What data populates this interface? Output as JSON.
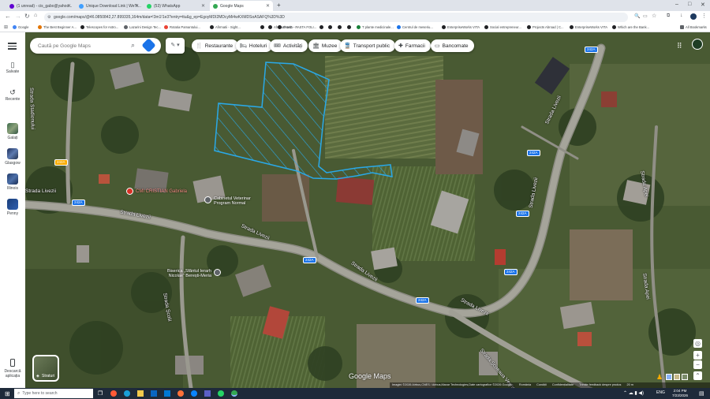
{
  "browser": {
    "tabs": [
      {
        "label": "(1 unread) - cis_gabo@yahoo...",
        "color": "#6001d2"
      },
      {
        "label": "Unique Download Link | WeTr...",
        "color": "#409fff"
      },
      {
        "label": "(53) WhatsApp",
        "color": "#25d366"
      },
      {
        "label": "Google Maps",
        "color": "#34a853"
      }
    ],
    "url": "google.com/maps/@46.0850842,27.899335,164m/data=!3m1!1e3?entry=ttu&g_ep=EgoyMDI2MDcyMi4wKXMDSoASAFQ%3D%3D",
    "bookmarks": [
      "Google",
      "The Best Beginner A...",
      "Telescopes for Astro...",
      "Lazarini Design Tec...",
      "Rotatia Pamantului...",
      "Afirmatii - Sight...",
      "Afrosudnaria - ...",
      "FAMD - PASTA FOLI...",
      "T plante medicinale...",
      "Centrul de meseriu...",
      "EnterpriseWorks VITA",
      "Social entrepreneur...",
      "Projects Abroad | C...",
      "EnterpriseWorks VITA",
      "Which are the Bank..."
    ],
    "all_bookmarks": "All Bookmarks"
  },
  "rail": {
    "items": [
      {
        "label": "Salvate"
      },
      {
        "label": "Recente"
      },
      {
        "label": "Galați"
      },
      {
        "label": "Glasgow"
      },
      {
        "label": "Illinois"
      },
      {
        "label": "Penny"
      }
    ],
    "download_label": "Descarcă aplicația"
  },
  "search": {
    "placeholder": "Caută pe Google Maps"
  },
  "chips": [
    {
      "label": "Restaurante",
      "icon": "fork-knife-icon"
    },
    {
      "label": "Hoteluri",
      "icon": "bed-icon"
    },
    {
      "label": "Activități",
      "icon": "ticket-icon"
    },
    {
      "label": "Muzee",
      "icon": "museum-icon"
    },
    {
      "label": "Transport public",
      "icon": "train-icon"
    },
    {
      "label": "Farmacii",
      "icon": "pharmacy-icon"
    },
    {
      "label": "Bancomate",
      "icon": "atm-icon"
    }
  ],
  "map": {
    "streets": [
      {
        "name": "Strada Stadionului"
      },
      {
        "name": "Strada Livezii"
      },
      {
        "name": "Strada Livezii"
      },
      {
        "name": "Strada Livezii"
      },
      {
        "name": "Strada Livezii"
      },
      {
        "name": "Strada Livezii"
      },
      {
        "name": "Strada Livezii"
      },
      {
        "name": "Strada Livezii"
      },
      {
        "name": "Strada Școlii"
      },
      {
        "name": "Strada Apei"
      },
      {
        "name": "Strada Apei"
      },
      {
        "name": "Strada Șoseaua Veche"
      }
    ],
    "shields": [
      "242A",
      "242A",
      "242A",
      "242A",
      "242A",
      "242A",
      "242A",
      "242A"
    ],
    "pois": [
      {
        "label": "CMI CRISTIAN Gabriela",
        "color": "#d93025"
      },
      {
        "label": "Cabinetul Veterinar Program Normal",
        "color": "#5f6368"
      },
      {
        "label": "Biserica „Sfântul Ierarh Nicolae” Berești-Meria",
        "color": "#5f6368"
      }
    ],
    "layer_label": "Straturi",
    "brand": "Google Maps",
    "footer": {
      "imagery": "Imagini ©2026 Airbus,CNES / Airbus,Maxar Technologies,Date cartografice ©2026 Google",
      "links": [
        "România",
        "Condiții",
        "Confidențialitate",
        "Trimite feedback despre produs"
      ],
      "scale": "20 m"
    }
  },
  "taskbar": {
    "search_placeholder": "Type here to search",
    "time": "2:04 PM",
    "date": "7/23/2026",
    "lang": "ENG"
  }
}
